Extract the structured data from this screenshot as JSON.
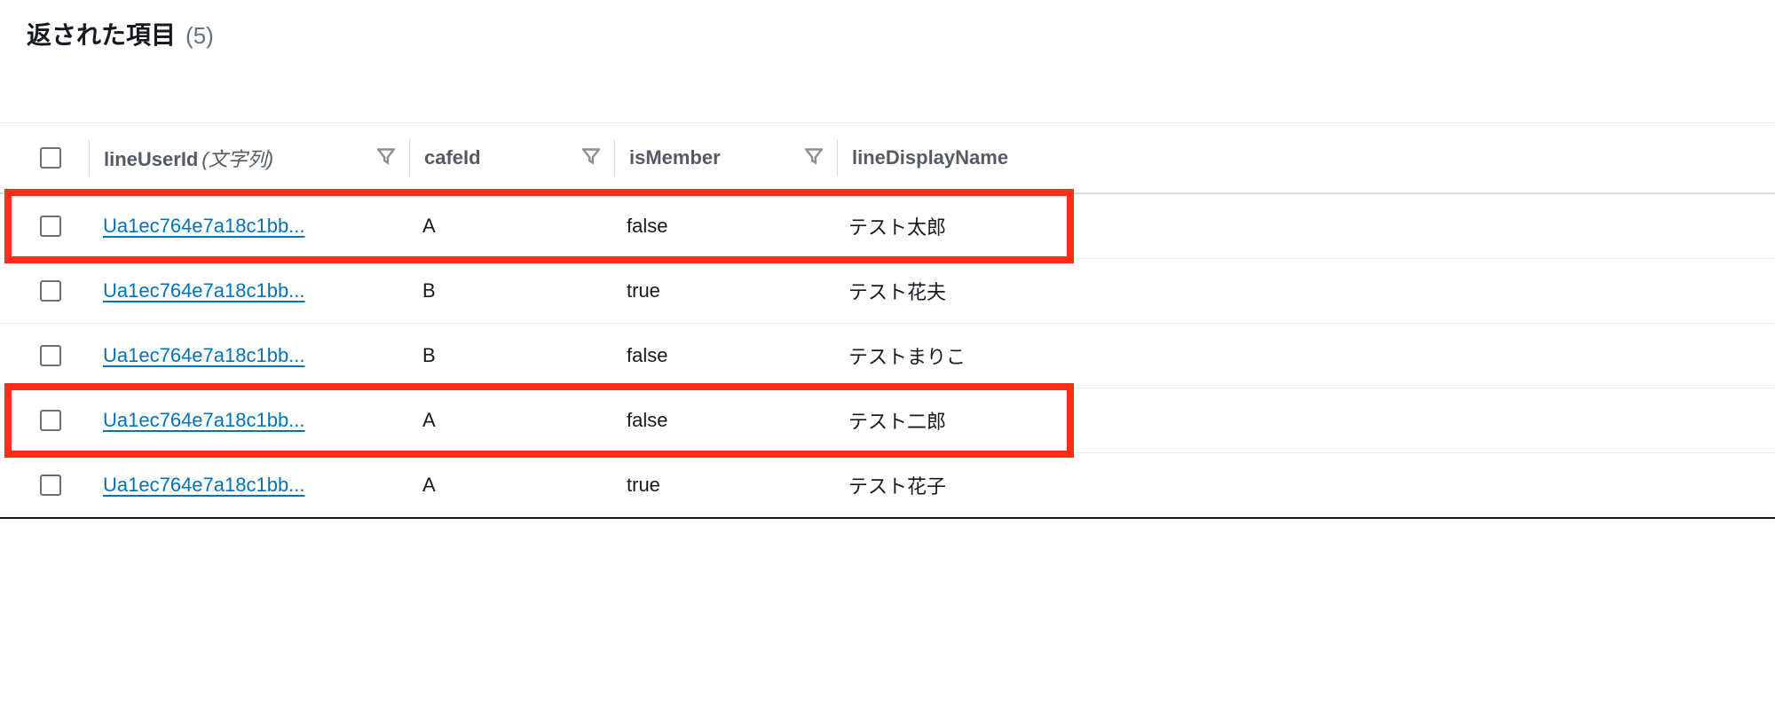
{
  "header": {
    "title": "返された項目",
    "count": "(5)"
  },
  "table": {
    "columns": {
      "lineUserId": {
        "label": "lineUserId",
        "type": "(文字列)"
      },
      "cafeId": {
        "label": "cafeId"
      },
      "isMember": {
        "label": "isMember"
      },
      "lineDisplayName": {
        "label": "lineDisplayName"
      }
    },
    "rows": [
      {
        "lineUserId": "Ua1ec764e7a18c1bb...",
        "cafeId": "A",
        "isMember": "false",
        "lineDisplayName": "テスト太郎",
        "highlighted": true
      },
      {
        "lineUserId": "Ua1ec764e7a18c1bb...",
        "cafeId": "B",
        "isMember": "true",
        "lineDisplayName": "テスト花夫",
        "highlighted": false
      },
      {
        "lineUserId": "Ua1ec764e7a18c1bb...",
        "cafeId": "B",
        "isMember": "false",
        "lineDisplayName": "テストまりこ",
        "highlighted": false
      },
      {
        "lineUserId": "Ua1ec764e7a18c1bb...",
        "cafeId": "A",
        "isMember": "false",
        "lineDisplayName": "テスト二郎",
        "highlighted": true
      },
      {
        "lineUserId": "Ua1ec764e7a18c1bb...",
        "cafeId": "A",
        "isMember": "true",
        "lineDisplayName": "テスト花子",
        "highlighted": false
      }
    ]
  },
  "colors": {
    "link": "#0073bb",
    "highlight": "#ff2d1a"
  }
}
